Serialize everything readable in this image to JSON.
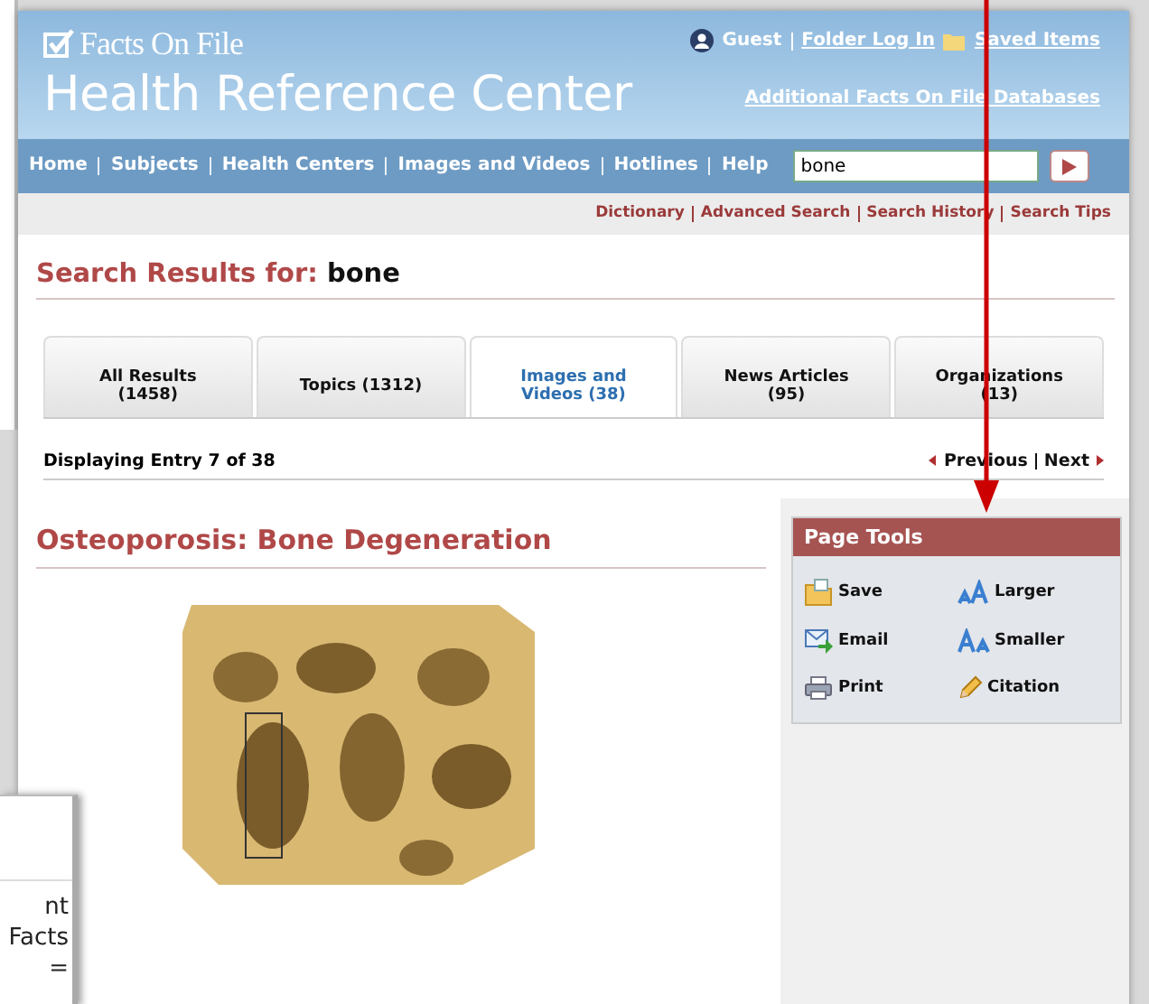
{
  "header": {
    "logo": "Facts On File",
    "title": "Health Reference Center",
    "user": "Guest",
    "links": [
      {
        "label": "Folder Log In",
        "kind": "login"
      },
      {
        "label": "Saved Items",
        "kind": "saved"
      }
    ],
    "additional_link": "Additional Facts On File Databases"
  },
  "nav": {
    "items": [
      "Home",
      "Subjects",
      "Health Centers",
      "Images and Videos",
      "Hotlines",
      "Help"
    ],
    "search": {
      "value": "bone"
    }
  },
  "sub_links": [
    "Dictionary",
    "Advanced Search",
    "Search History",
    "Search Tips"
  ],
  "search_results": {
    "label": "Search Results for:",
    "query": "bone"
  },
  "tabs": [
    {
      "label": "All Results (1458)",
      "selected": false
    },
    {
      "label": "Topics (1312)",
      "selected": false
    },
    {
      "label": "Images and Videos (38)",
      "selected": true
    },
    {
      "label": "News Articles (95)",
      "selected": false
    },
    {
      "label": "Organizations (13)",
      "selected": false
    }
  ],
  "pager": {
    "status": "Displaying Entry 7 of 38",
    "previous": "Previous",
    "next": "Next"
  },
  "article": {
    "title": "Osteoporosis: Bone Degeneration"
  },
  "page_tools": {
    "title": "Page Tools",
    "items": [
      {
        "label": "Save",
        "kind": "save"
      },
      {
        "label": "Larger",
        "kind": "larger"
      },
      {
        "label": "Email",
        "kind": "email"
      },
      {
        "label": "Smaller",
        "kind": "smaller"
      },
      {
        "label": "Print",
        "kind": "print"
      },
      {
        "label": "Citation",
        "kind": "citation"
      }
    ]
  },
  "overlay_window": {
    "lines": [
      "nt",
      "Facts",
      "="
    ]
  }
}
